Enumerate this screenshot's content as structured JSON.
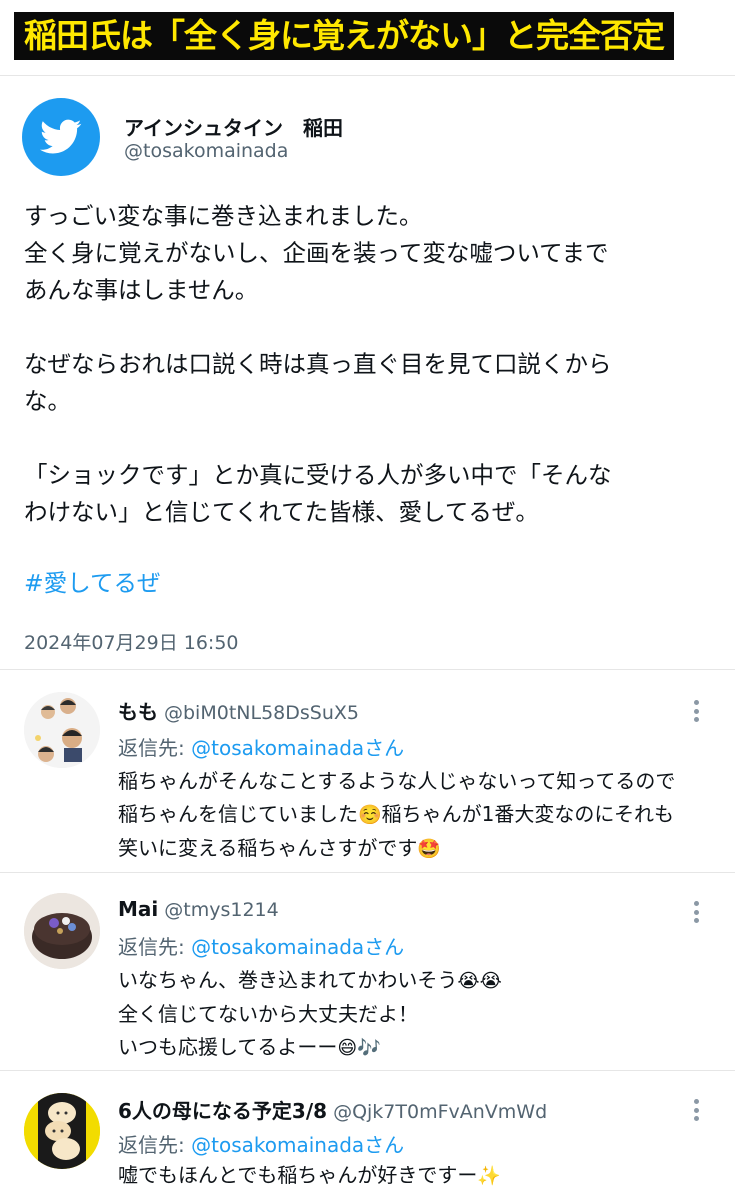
{
  "headline": {
    "text": "稲田氏は「全く身に覚えがない」と完全否定"
  },
  "tweet": {
    "display_name": "アインシュタイン　稲田",
    "handle": "@tosakomainada",
    "body_lines": [
      "すっごい変な事に巻き込まれました。",
      "全く身に覚えがないし、企画を装って変な嘘ついてまで",
      "あんな事はしません。",
      "",
      "なぜならおれは口説く時は真っ直ぐ目を見て口説くから",
      "な。",
      "",
      "「ショックです」とか真に受ける人が多い中で「そんな",
      "わけない」と信じてくれてた皆様、愛してるぜ。"
    ],
    "hashtag": "#愛してるぜ",
    "timestamp": "2024年07月29日 16:50",
    "avatar_icon": "twitter-bird-icon",
    "accent_color": "#1d9bf0"
  },
  "replies": [
    {
      "name": "もも",
      "handle": "@biM0tNL58DsSuX5",
      "reply_to_prefix": "返信先: ",
      "reply_to_handle": "@tosakomainadaさん",
      "lines": [
        "稲ちゃんがそんなことするような人じゃないって知ってるので",
        "稲ちゃんを信じていました",
        "稲ちゃんが1番大変なのにそれも",
        "笑いに変える稲ちゃんさすがです"
      ],
      "emojis": [
        "☺️",
        "🤩"
      ]
    },
    {
      "name": "Mai",
      "handle": "@tmys1214",
      "reply_to_prefix": "返信先: ",
      "reply_to_handle": "@tosakomainadaさん",
      "lines": [
        "いなちゃん、巻き込まれてかわいそう",
        "全く信じてないから大丈夫だよ！",
        "いつも応援してるよーー"
      ],
      "emojis": [
        "😭😭",
        "😄🎶"
      ]
    },
    {
      "name": "6人の母になる予定3/8",
      "handle": "@Qjk7T0mFvAnVmWd",
      "reply_to_prefix": "返信先: ",
      "reply_to_handle": "@tosakomainadaさん",
      "lines": [
        "嘘でもほんとでも稲ちゃんが好きですー"
      ],
      "emojis": [
        "✨"
      ]
    }
  ]
}
